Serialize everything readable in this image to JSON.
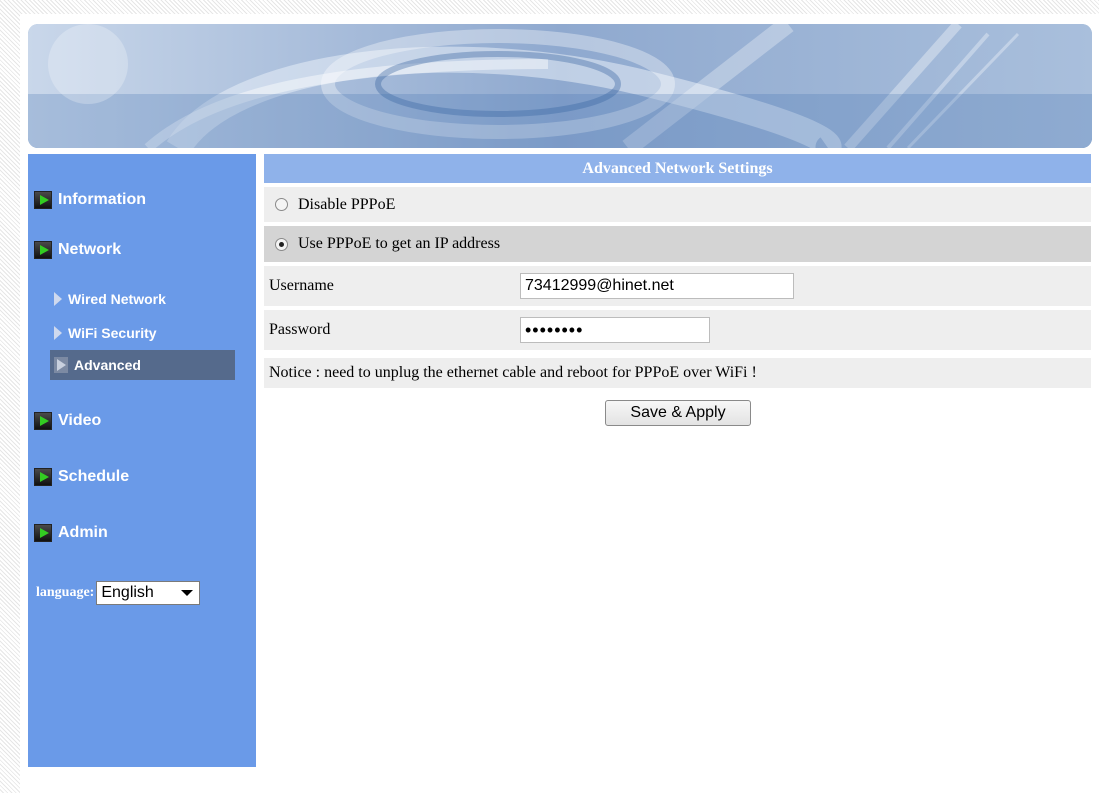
{
  "sidebar": {
    "items": [
      {
        "label": "Information",
        "icon": "play-arrow-icon"
      },
      {
        "label": "Network",
        "icon": "play-arrow-icon"
      },
      {
        "label": "Video",
        "icon": "play-arrow-icon"
      },
      {
        "label": "Schedule",
        "icon": "play-arrow-icon"
      },
      {
        "label": "Admin",
        "icon": "play-arrow-icon"
      }
    ],
    "network_sub": [
      {
        "label": "Wired Network"
      },
      {
        "label": "WiFi Security"
      },
      {
        "label": "Advanced",
        "active": true
      }
    ],
    "language_label": "language:",
    "language_value": "English"
  },
  "main": {
    "title": "Advanced Network Settings",
    "disable_pppoe_label": "Disable PPPoE",
    "use_pppoe_label": "Use PPPoE to get an IP address",
    "selected_option": "use_pppoe",
    "username_label": "Username",
    "username_value": "73412999@hinet.net",
    "password_label": "Password",
    "password_value": "••••••••",
    "notice": "Notice : need to unplug the ethernet cable and reboot for PPPoE over WiFi !",
    "save_label": "Save & Apply"
  },
  "colors": {
    "sidebar_bg": "#6a9ae8",
    "title_bar_bg": "#8fb2ea",
    "active_sub_bg": "#556a8c",
    "row_bg": "#eeeeee",
    "row_selected_bg": "#d4d4d4"
  }
}
